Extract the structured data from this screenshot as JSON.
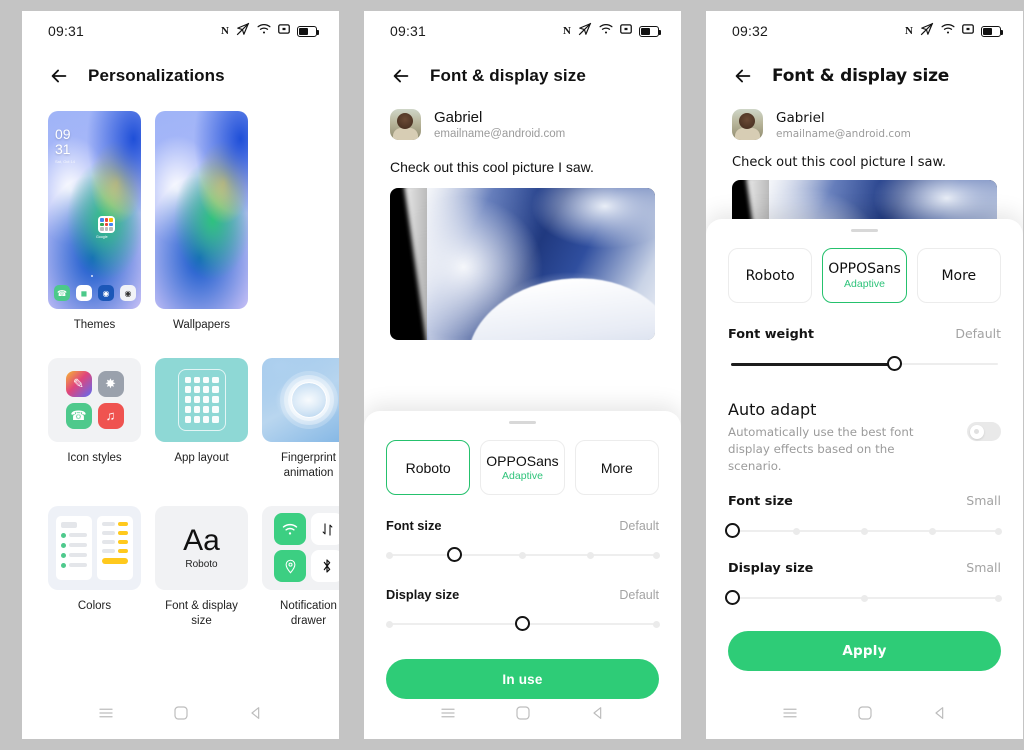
{
  "panels": [
    {
      "id": "personalizations",
      "status": {
        "time": "09:31",
        "icons": [
          "nfc-icon",
          "location-off-icon",
          "wifi-icon",
          "screen-record-icon",
          "battery-icon"
        ]
      },
      "header": {
        "back": "back-arrow",
        "title": "Personalizations"
      },
      "grid": {
        "rows": [
          [
            {
              "label": "Themes",
              "tile": "wallpaper-preview-lockscreen",
              "lockscreen": {
                "hour": "09",
                "minute": "31",
                "date": "Sat, Oct 14",
                "google_label": "Google"
              }
            },
            {
              "label": "Wallpapers",
              "tile": "wallpaper-preview-plain"
            }
          ],
          [
            {
              "label": "Icon styles",
              "tile": "icon-styles-preview"
            },
            {
              "label": "App layout",
              "tile": "app-layout-preview"
            },
            {
              "label": "Fingerprint\nanimation",
              "tile": "fingerprint-animation-preview"
            }
          ],
          [
            {
              "label": "Colors",
              "tile": "colors-preview"
            },
            {
              "label": "Font & display\nsize",
              "tile": "font-preview",
              "sample": "Aa",
              "sample_name": "Roboto"
            },
            {
              "label": "Notification\ndrawer",
              "tile": "notification-drawer-preview",
              "quick_icons": [
                "wifi-icon",
                "data-transfer-icon",
                "location-icon",
                "bluetooth-icon"
              ]
            }
          ]
        ]
      },
      "navbar": [
        "menu-icon",
        "home-icon",
        "back-icon"
      ]
    },
    {
      "id": "font-display-size-roboto",
      "status": {
        "time": "09:31",
        "icons": [
          "nfc-icon",
          "location-off-icon",
          "wifi-icon",
          "screen-record-icon",
          "battery-icon"
        ]
      },
      "header": {
        "back": "back-arrow",
        "title": "Font & display size"
      },
      "preview": {
        "sender_name": "Gabriel",
        "sender_email": "emailname@android.com",
        "message": "Check out this cool picture I saw.",
        "photo_alt": "blue-white-abstract-wave-photo"
      },
      "sheet": {
        "fonts": [
          {
            "name": "Roboto",
            "sub": "",
            "selected": true
          },
          {
            "name": "OPPOSans",
            "sub": "Adaptive",
            "selected": false
          },
          {
            "name": "More",
            "sub": "",
            "selected": false
          }
        ],
        "settings": [
          {
            "label": "Font size",
            "value": "Default",
            "ticks": 5,
            "position": 1
          },
          {
            "label": "Display size",
            "value": "Default",
            "ticks": 2,
            "position": 0.5
          }
        ],
        "cta": "In use"
      },
      "navbar": [
        "menu-icon",
        "home-icon",
        "back-icon"
      ]
    },
    {
      "id": "font-display-size-opposans",
      "status": {
        "time": "09:32",
        "icons": [
          "nfc-icon",
          "location-off-icon",
          "wifi-icon",
          "screen-record-icon",
          "battery-icon"
        ]
      },
      "header": {
        "back": "back-arrow",
        "title": "Font & display size"
      },
      "preview": {
        "sender_name": "Gabriel",
        "sender_email": "emailname@android.com",
        "message": "Check out this cool picture I saw.",
        "photo_alt": "blue-white-abstract-wave-photo"
      },
      "sheet": {
        "fonts": [
          {
            "name": "Roboto",
            "sub": "",
            "selected": false
          },
          {
            "name": "OPPOSans",
            "sub": "Adaptive",
            "selected": true
          },
          {
            "name": "More",
            "sub": "",
            "selected": false
          }
        ],
        "font_weight": {
          "label": "Font weight",
          "value": "Default",
          "position": 0.61
        },
        "auto_adapt": {
          "title": "Auto adapt",
          "description": "Automatically use the best font display effects based on the scenario.",
          "enabled": false
        },
        "settings": [
          {
            "label": "Font size",
            "value": "Small",
            "ticks": 5,
            "position": 0
          },
          {
            "label": "Display size",
            "value": "Small",
            "ticks": 3,
            "position": 0
          }
        ],
        "cta": "Apply"
      },
      "navbar": [
        "menu-icon",
        "home-icon",
        "back-icon"
      ]
    }
  ],
  "colors": {
    "accent_green": "#2ecc77",
    "selected_border": "#25c16d",
    "adaptive_text": "#2ec37a",
    "muted": "#a3a3a3"
  }
}
